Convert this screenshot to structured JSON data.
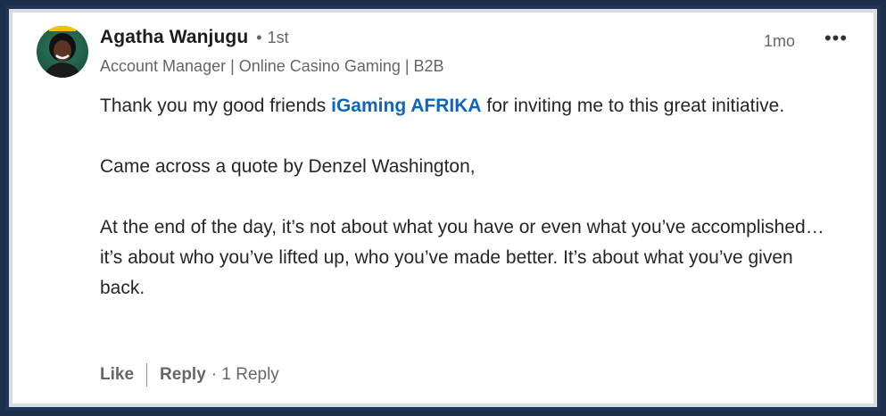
{
  "comment": {
    "author_name": "Agatha Wanjugu",
    "degree_separator": "•",
    "connection_degree": "1st",
    "headline": "Account Manager | Online Casino Gaming | B2B",
    "timestamp": "1mo",
    "more_icon": "more-horizontal-icon",
    "more_label": "•••",
    "text": {
      "p1_before": "Thank you my good friends ",
      "p1_link": "iGaming AFRIKA",
      "p1_after": " for inviting me to this great initiative.",
      "p2": "Came across a quote by Denzel Washington,",
      "p3": "At the end of the day, it’s not about what you have or even what you’ve accomplished… it’s about who you’ve lifted up, who you’ve made better. It’s about what you’ve given back."
    },
    "link_color": "#0a66c2"
  },
  "actions": {
    "like_label": "Like",
    "reply_label": "Reply",
    "reply_count": "· 1 Reply"
  }
}
